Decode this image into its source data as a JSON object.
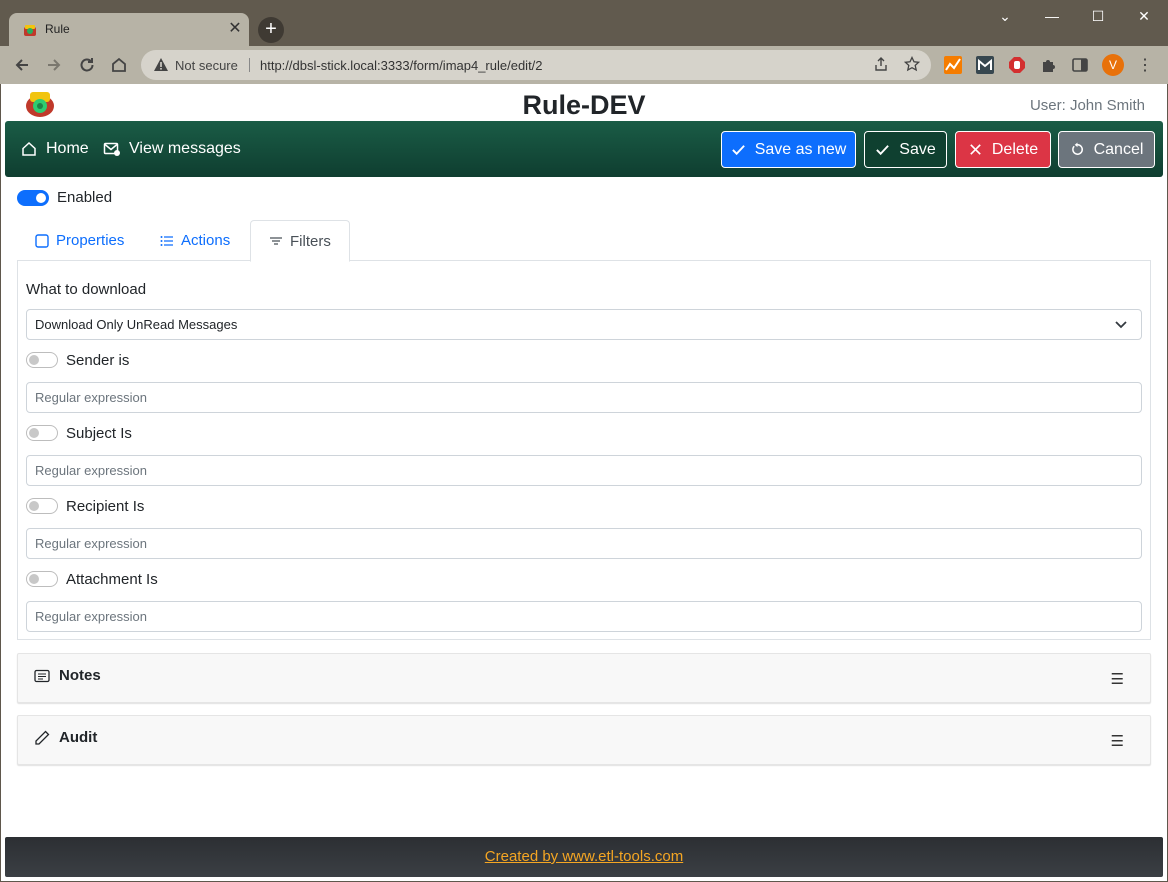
{
  "browser": {
    "tab_title": "Rule",
    "tab_close": "✕",
    "new_tab": "+",
    "not_secure": "Not secure",
    "url": "http://dbsl-stick.local:3333/form/imap4_rule/edit/2",
    "avatar_letter": "V",
    "minimize": "⌄",
    "restore": "—",
    "maximize": "☐",
    "close": "✕"
  },
  "header": {
    "title": "Rule-DEV",
    "user": "User: John Smith"
  },
  "navbar": {
    "home": "Home",
    "view_messages": "View messages",
    "save_as_new": "Save as new",
    "save": "Save",
    "delete": "Delete",
    "cancel": "Cancel"
  },
  "enabled": {
    "label": "Enabled",
    "on": true
  },
  "tabs": [
    {
      "label": "Properties",
      "active": false
    },
    {
      "label": "Actions",
      "active": false
    },
    {
      "label": "Filters",
      "active": true
    }
  ],
  "filters": {
    "what_to_download_label": "What to download",
    "what_to_download_value": "Download Only UnRead Messages",
    "sender_label": "Sender is",
    "subject_label": "Subject Is",
    "recipient_label": "Recipient Is",
    "attachment_label": "Attachment Is",
    "placeholder": "Regular expression"
  },
  "sections": {
    "notes": "Notes",
    "audit": "Audit",
    "menu_glyph": "☰"
  },
  "footer": {
    "link": "Created by www.etl-tools.com"
  },
  "colors": {
    "navbar": "#174f3d",
    "primary": "#0d6efd",
    "danger": "#dc3545",
    "secondary": "#6c757d",
    "footer_link": "#f5a623"
  }
}
